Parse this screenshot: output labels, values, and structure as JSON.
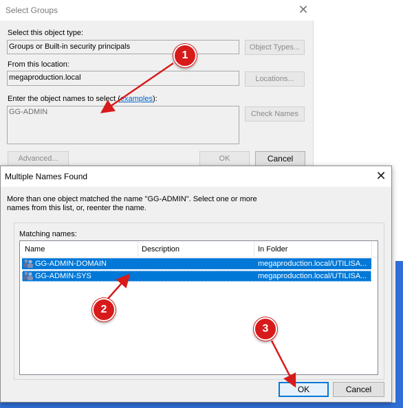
{
  "background_dialog": {
    "title": "Select Groups",
    "object_type_label": "Select this object type:",
    "object_type_value": "Groups or Built-in security principals",
    "object_types_button": "Object Types...",
    "location_label": "From this location:",
    "location_value": "megaproduction.local",
    "locations_button": "Locations...",
    "names_label": "Enter the object names to select (",
    "names_link": "examples",
    "names_label_end": "):",
    "names_value": "GG-ADMIN",
    "check_names_button": "Check Names",
    "advanced_button": "Advanced...",
    "ok_button": "OK",
    "cancel_button": "Cancel"
  },
  "dialog": {
    "title": "Multiple Names Found",
    "message": "More than one object matched the name \"GG-ADMIN\". Select one or more names from this list, or, reenter the name.",
    "matching_label": "Matching names:",
    "columns": [
      "Name",
      "Description",
      "In Folder"
    ],
    "rows": [
      {
        "name": "GG-ADMIN-DOMAIN",
        "description": "",
        "folder": "megaproduction.local/UTILISA..."
      },
      {
        "name": "GG-ADMIN-SYS",
        "description": "",
        "folder": "megaproduction.local/UTILISA..."
      }
    ],
    "ok_button": "OK",
    "cancel_button": "Cancel"
  },
  "annotations": {
    "badges": [
      "1",
      "2",
      "3"
    ],
    "color": "#d71b1b"
  },
  "icons": {
    "row_icon": "group-icon",
    "close": "close-icon"
  }
}
